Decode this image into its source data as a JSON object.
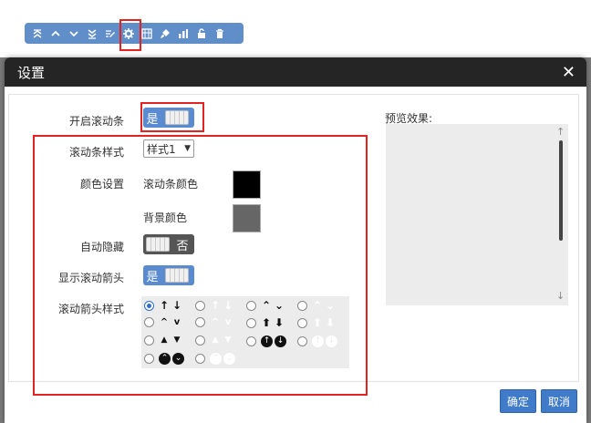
{
  "toolbar": {
    "icons": [
      "double-up-icon",
      "chevron-up-icon",
      "chevron-down-icon",
      "double-down-icon",
      "edit-icon",
      "gear-icon",
      "grid-icon",
      "brush-icon",
      "chart-icon",
      "unlock-icon",
      "trash-icon"
    ]
  },
  "dialog": {
    "title": "设置",
    "close": "✕",
    "rows": {
      "enable_scrollbar": {
        "label": "开启滚动条",
        "state": "是"
      },
      "scrollbar_style": {
        "label": "滚动条样式",
        "selected": "样式1"
      },
      "color_settings": {
        "label": "颜色设置",
        "bar_color_label": "滚动条颜色",
        "bar_color": "#000000",
        "bg_color_label": "背景颜色",
        "bg_color": "#666666"
      },
      "auto_hide": {
        "label": "自动隐藏",
        "state": "否"
      },
      "show_arrows": {
        "label": "显示滚动箭头",
        "state": "是"
      },
      "arrow_style": {
        "label": "滚动箭头样式"
      }
    },
    "preview": {
      "label": "预览效果:",
      "up": "↑",
      "down": "↓"
    },
    "buttons": {
      "ok": "确定",
      "cancel": "取消"
    }
  },
  "colors": {
    "accent": "#5a8bd1",
    "highlight": "#e52222",
    "header": "#252525"
  }
}
